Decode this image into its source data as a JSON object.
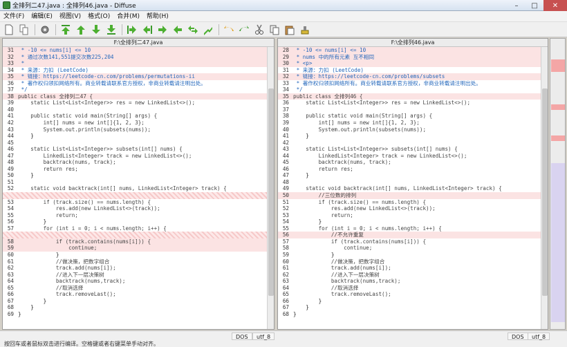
{
  "window": {
    "title": "全排列二47.java : 全排列46.java - Diffuse"
  },
  "menu": [
    "文件(F)",
    "编辑(E)",
    "视图(V)",
    "格式(O)",
    "合并(M)",
    "帮助(H)"
  ],
  "toolbar_icons": [
    "new-file-icon",
    "copy-file-icon",
    "settings-icon",
    "first-difference-icon",
    "previous-difference-icon",
    "next-difference-icon",
    "last-difference-icon",
    "copy-right-icon",
    "copy-left-icon",
    "arrow-right-icon",
    "arrow-left-icon",
    "swap-icon",
    "merge-icon",
    "undo-icon",
    "redo-icon",
    "cut-icon",
    "copy-icon",
    "paste-icon",
    "clear-edits-icon"
  ],
  "left_pane": {
    "header": "F:\\全排列二47.java",
    "lines": [
      {
        "n": "31",
        "t": " * -10 <= nums[i] <= 10",
        "c": "chg cmt"
      },
      {
        "n": "32",
        "t": " * 通过次数141,551提交次数225,204",
        "c": "chg cmt"
      },
      {
        "n": "33",
        "t": " *",
        "c": "chg cmt"
      },
      {
        "n": "34",
        "t": " * 来源：力扣 (LeetCode)",
        "c": "cmt"
      },
      {
        "n": "35",
        "t": " * 链接：https://leetcode-cn.com/problems/permutations-ii",
        "c": "chg cmt"
      },
      {
        "n": "36",
        "t": " * 著作权归领扣网络所有。商业转载请联系官方授权，非商业转载请注明出处。",
        "c": "cmt"
      },
      {
        "n": "37",
        "t": " */",
        "c": "cmt"
      },
      {
        "n": "38",
        "t": "public class 全排列二47 {",
        "c": "chg kw"
      },
      {
        "n": "39",
        "t": "    static List<List<Integer>> res = new LinkedList<>();",
        "c": "kw"
      },
      {
        "n": "40",
        "t": "",
        "c": ""
      },
      {
        "n": "41",
        "t": "    public static void main(String[] args) {",
        "c": "kw"
      },
      {
        "n": "42",
        "t": "        int[] nums = new int[]{1, 2, 3};",
        "c": "kw"
      },
      {
        "n": "43",
        "t": "        System.out.println(subsets(nums));",
        "c": "kw"
      },
      {
        "n": "44",
        "t": "    }",
        "c": ""
      },
      {
        "n": "45",
        "t": "",
        "c": ""
      },
      {
        "n": "46",
        "t": "    static List<List<Integer>> subsets(int[] nums) {",
        "c": "kw"
      },
      {
        "n": "47",
        "t": "        LinkedList<Integer> track = new LinkedList<>();",
        "c": "kw"
      },
      {
        "n": "48",
        "t": "        backtrack(nums, track);",
        "c": "kw"
      },
      {
        "n": "49",
        "t": "        return res;",
        "c": "kw"
      },
      {
        "n": "50",
        "t": "    }",
        "c": ""
      },
      {
        "n": "51",
        "t": "",
        "c": ""
      },
      {
        "n": "52",
        "t": "    static void backtrack(int[] nums, LinkedList<Integer> track) {",
        "c": "kw"
      },
      {
        "n": "",
        "t": "",
        "c": "blank"
      },
      {
        "n": "53",
        "t": "        if (track.size() == nums.length) {",
        "c": "kw"
      },
      {
        "n": "54",
        "t": "            res.add(new LinkedList<>(track));",
        "c": "kw"
      },
      {
        "n": "55",
        "t": "            return;",
        "c": "kw"
      },
      {
        "n": "56",
        "t": "        }",
        "c": ""
      },
      {
        "n": "57",
        "t": "        for (int i = 0; i < nums.length; i++) {",
        "c": "kw"
      },
      {
        "n": "",
        "t": "",
        "c": "blank"
      },
      {
        "n": "58",
        "t": "            if (track.contains(nums[i])) {",
        "c": "chg kw"
      },
      {
        "n": "59",
        "t": "                continue;",
        "c": "chg kw"
      },
      {
        "n": "60",
        "t": "            }",
        "c": ""
      },
      {
        "n": "61",
        "t": "            //做决策，把数字组合",
        "c": "kw"
      },
      {
        "n": "62",
        "t": "            track.add(nums[i]);",
        "c": "kw"
      },
      {
        "n": "63",
        "t": "            //进入下一层决策树",
        "c": "kw"
      },
      {
        "n": "64",
        "t": "            backtrack(nums,track);",
        "c": "kw"
      },
      {
        "n": "65",
        "t": "            //取消选择",
        "c": "kw"
      },
      {
        "n": "66",
        "t": "            track.removeLast();",
        "c": "kw"
      },
      {
        "n": "67",
        "t": "        }",
        "c": ""
      },
      {
        "n": "68",
        "t": "    }",
        "c": ""
      },
      {
        "n": "69",
        "t": "}",
        "c": ""
      }
    ]
  },
  "right_pane": {
    "header": "F:\\全排列46.java",
    "lines": [
      {
        "n": "28",
        "t": " * -10 <= nums[i] <= 10",
        "c": "chg cmt"
      },
      {
        "n": "29",
        "t": " * nums 中的所有元素 互不相同",
        "c": "chg cmt"
      },
      {
        "n": "30",
        "t": " * <p>",
        "c": "chg cmt"
      },
      {
        "n": "31",
        "t": " * 来源：力扣 (LeetCode)",
        "c": "cmt"
      },
      {
        "n": "32",
        "t": " * 链接：https://leetcode-cn.com/problems/subsets",
        "c": "chg cmt"
      },
      {
        "n": "33",
        "t": " * 著作权归领扣网络所有。商业转载请联系官方授权，非商业转载请注明出处。",
        "c": "cmt"
      },
      {
        "n": "34",
        "t": " */",
        "c": "cmt"
      },
      {
        "n": "35",
        "t": "public class 全排列46 {",
        "c": "chg kw"
      },
      {
        "n": "36",
        "t": "    static List<List<Integer>> res = new LinkedList<>();",
        "c": "kw"
      },
      {
        "n": "37",
        "t": "",
        "c": ""
      },
      {
        "n": "38",
        "t": "    public static void main(String[] args) {",
        "c": "kw"
      },
      {
        "n": "39",
        "t": "        int[] nums = new int[]{1, 2, 3};",
        "c": "kw"
      },
      {
        "n": "40",
        "t": "        System.out.println(subsets(nums));",
        "c": "kw"
      },
      {
        "n": "41",
        "t": "    }",
        "c": ""
      },
      {
        "n": "42",
        "t": "",
        "c": ""
      },
      {
        "n": "43",
        "t": "    static List<List<Integer>> subsets(int[] nums) {",
        "c": "kw"
      },
      {
        "n": "44",
        "t": "        LinkedList<Integer> track = new LinkedList<>();",
        "c": "kw"
      },
      {
        "n": "45",
        "t": "        backtrack(nums, track);",
        "c": "kw"
      },
      {
        "n": "46",
        "t": "        return res;",
        "c": "kw"
      },
      {
        "n": "47",
        "t": "    }",
        "c": ""
      },
      {
        "n": "48",
        "t": "",
        "c": ""
      },
      {
        "n": "49",
        "t": "    static void backtrack(int[] nums, LinkedList<Integer> track) {",
        "c": "kw"
      },
      {
        "n": "50",
        "t": "        //三位数的排列",
        "c": "chg kw"
      },
      {
        "n": "51",
        "t": "        if (track.size() == nums.length) {",
        "c": "kw"
      },
      {
        "n": "52",
        "t": "            res.add(new LinkedList<>(track));",
        "c": "kw"
      },
      {
        "n": "53",
        "t": "            return;",
        "c": "kw"
      },
      {
        "n": "54",
        "t": "        }",
        "c": ""
      },
      {
        "n": "55",
        "t": "        for (int i = 0; i < nums.length; i++) {",
        "c": "kw"
      },
      {
        "n": "56",
        "t": "            //不允许重复",
        "c": "chg kw"
      },
      {
        "n": "57",
        "t": "            if (track.contains(nums[i])) {",
        "c": "kw"
      },
      {
        "n": "58",
        "t": "                continue;",
        "c": "kw"
      },
      {
        "n": "59",
        "t": "            }",
        "c": ""
      },
      {
        "n": "60",
        "t": "            //做决策，把数字组合",
        "c": "kw"
      },
      {
        "n": "61",
        "t": "            track.add(nums[i]);",
        "c": "kw"
      },
      {
        "n": "62",
        "t": "            //进入下一层决策树",
        "c": "kw"
      },
      {
        "n": "63",
        "t": "            backtrack(nums,track);",
        "c": "kw"
      },
      {
        "n": "64",
        "t": "            //取消选择",
        "c": "kw"
      },
      {
        "n": "65",
        "t": "            track.removeLast();",
        "c": "kw"
      },
      {
        "n": "66",
        "t": "        }",
        "c": ""
      },
      {
        "n": "67",
        "t": "    }",
        "c": ""
      },
      {
        "n": "68",
        "t": "}",
        "c": ""
      }
    ]
  },
  "status": {
    "left_eol": "DOS",
    "left_enc": "utf_8",
    "right_eol": "DOS",
    "right_enc": "utf_8",
    "hint": "按回车或者鼠标双击进行编译。空格键或者右键菜单手动对齐。"
  },
  "colors": {
    "change_bg": "#fbe3e3",
    "blank_hatch": "#f6c9c9",
    "comment": "#2266bb"
  }
}
